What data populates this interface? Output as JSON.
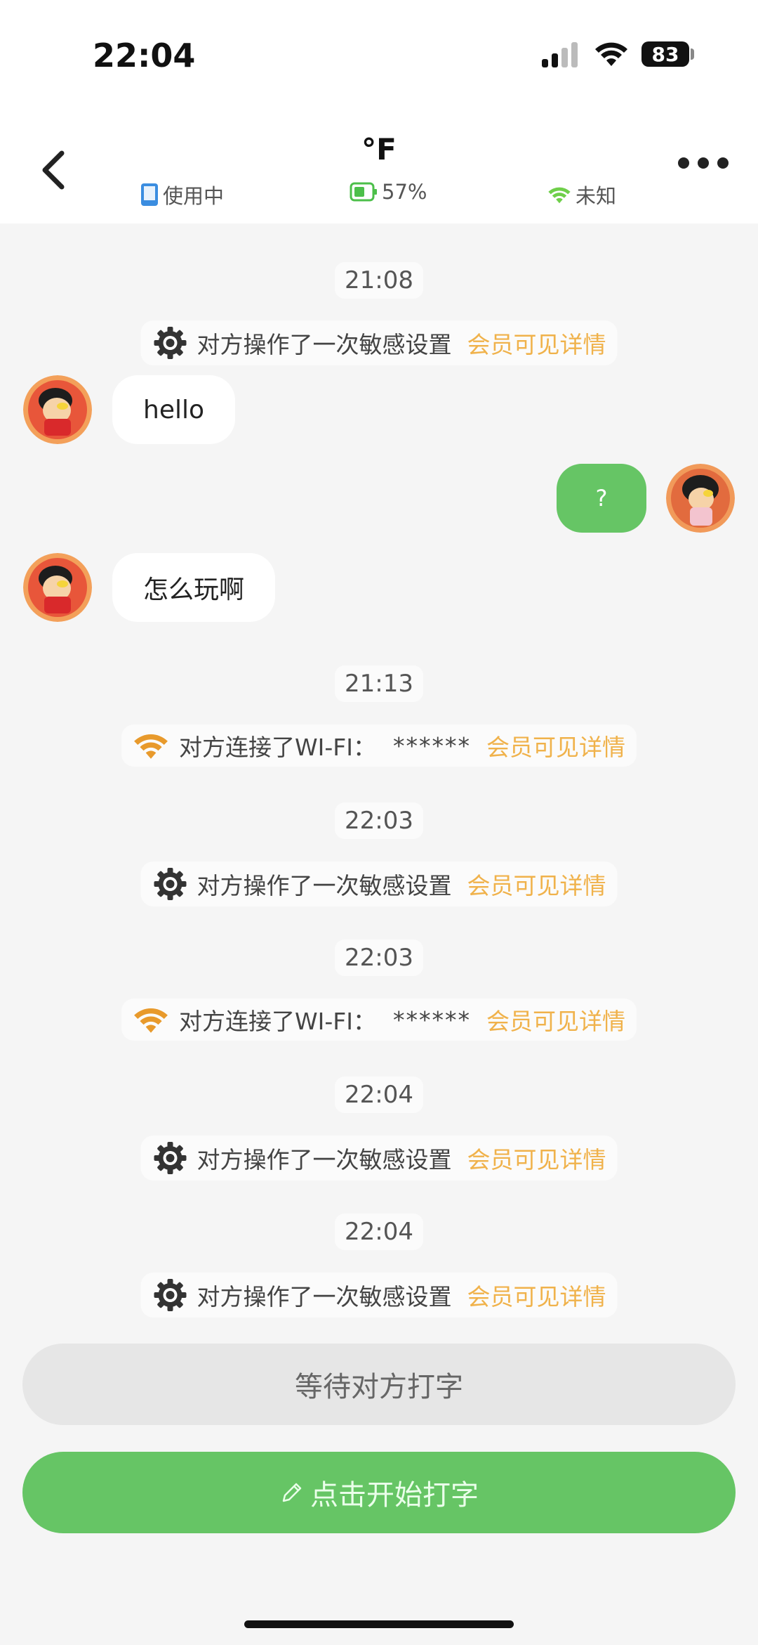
{
  "status_bar": {
    "time": "22:04",
    "battery": "83"
  },
  "header": {
    "title": "°F",
    "device_status": "使用中",
    "battery_level": "57%",
    "network": "未知"
  },
  "messages": {
    "t1": "21:08",
    "sys1": {
      "text": "对方操作了一次敏感设置",
      "link": "会员可见详情"
    },
    "in1": "hello",
    "out1": "?",
    "in2": "怎么玩啊",
    "t2": "21:13",
    "sys2": {
      "text": "对方连接了WI-FI：",
      "masked": "******",
      "link": "会员可见详情"
    },
    "t3": "22:03",
    "sys3": {
      "text": "对方操作了一次敏感设置",
      "link": "会员可见详情"
    },
    "t4": "22:03",
    "sys4": {
      "text": "对方连接了WI-FI：",
      "masked": "******",
      "link": "会员可见详情"
    },
    "t5": "22:04",
    "sys5": {
      "text": "对方操作了一次敏感设置",
      "link": "会员可见详情"
    },
    "t6": "22:04",
    "sys6": {
      "text": "对方操作了一次敏感设置",
      "link": "会员可见详情"
    }
  },
  "actions": {
    "waiting_label": "等待对方打字",
    "start_typing_label": "点击开始打字"
  },
  "colors": {
    "accent": "#66c565",
    "gold": "#f0b24b",
    "wifi": "#e89a2c"
  }
}
